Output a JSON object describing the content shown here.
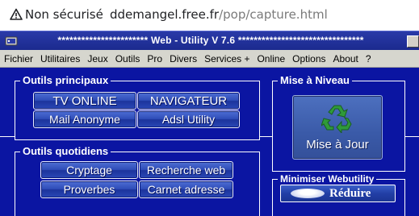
{
  "browser": {
    "security_label": "Non sécurisé",
    "url_host": "ddemangel.free.fr",
    "url_path": "/pop/capture.html",
    "warning_icon": "warning-triangle-icon"
  },
  "window": {
    "title": "*********************** Web - Utility V 7.6 ********************************"
  },
  "menu": [
    "Fichier",
    "Utilitaires",
    "Jeux",
    "Outils",
    "Pro",
    "Divers",
    "Services +",
    "Online",
    "Options",
    "About",
    "?"
  ],
  "groups": {
    "principal": {
      "title": "Outils principaux",
      "buttons": [
        "TV ONLINE",
        "NAVIGATEUR",
        "Mail Anonyme",
        "Adsl Utility"
      ]
    },
    "quotidien": {
      "title": "Outils quotidiens",
      "buttons": [
        "Cryptage",
        "Recherche web",
        "Proverbes",
        "Carnet adresse"
      ]
    },
    "update": {
      "title": "Mise à Niveau",
      "button_label": "Mise à Jour",
      "icon": "recycle-icon"
    },
    "minimize": {
      "title": "Minimiser Webutility",
      "button_label": "Réduire"
    }
  },
  "colors": {
    "app_background": "#0b15a2",
    "menubar": "#d6d6ce",
    "recycle_green": "#2f9a3a"
  }
}
